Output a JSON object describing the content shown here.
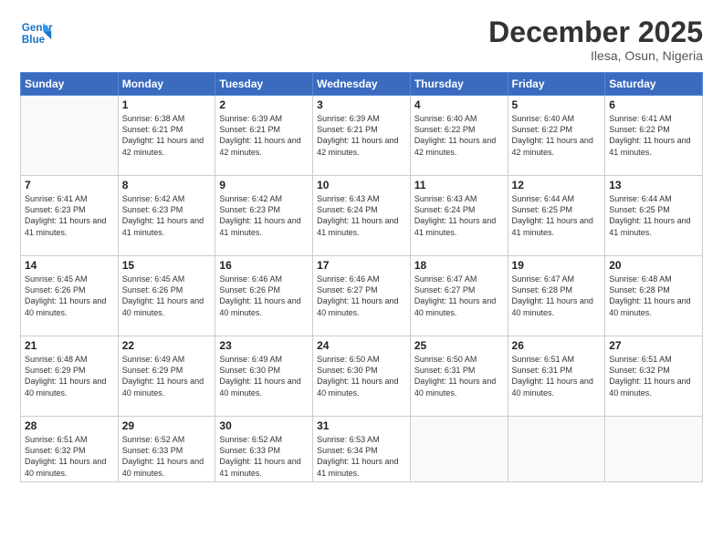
{
  "header": {
    "logo_line1": "General",
    "logo_line2": "Blue",
    "month_title": "December 2025",
    "location": "Ilesa, Osun, Nigeria"
  },
  "weekdays": [
    "Sunday",
    "Monday",
    "Tuesday",
    "Wednesday",
    "Thursday",
    "Friday",
    "Saturday"
  ],
  "weeks": [
    [
      {
        "day": "",
        "sunrise": "",
        "sunset": "",
        "daylight": ""
      },
      {
        "day": "1",
        "sunrise": "Sunrise: 6:38 AM",
        "sunset": "Sunset: 6:21 PM",
        "daylight": "Daylight: 11 hours and 42 minutes."
      },
      {
        "day": "2",
        "sunrise": "Sunrise: 6:39 AM",
        "sunset": "Sunset: 6:21 PM",
        "daylight": "Daylight: 11 hours and 42 minutes."
      },
      {
        "day": "3",
        "sunrise": "Sunrise: 6:39 AM",
        "sunset": "Sunset: 6:21 PM",
        "daylight": "Daylight: 11 hours and 42 minutes."
      },
      {
        "day": "4",
        "sunrise": "Sunrise: 6:40 AM",
        "sunset": "Sunset: 6:22 PM",
        "daylight": "Daylight: 11 hours and 42 minutes."
      },
      {
        "day": "5",
        "sunrise": "Sunrise: 6:40 AM",
        "sunset": "Sunset: 6:22 PM",
        "daylight": "Daylight: 11 hours and 42 minutes."
      },
      {
        "day": "6",
        "sunrise": "Sunrise: 6:41 AM",
        "sunset": "Sunset: 6:22 PM",
        "daylight": "Daylight: 11 hours and 41 minutes."
      }
    ],
    [
      {
        "day": "7",
        "sunrise": "Sunrise: 6:41 AM",
        "sunset": "Sunset: 6:23 PM",
        "daylight": "Daylight: 11 hours and 41 minutes."
      },
      {
        "day": "8",
        "sunrise": "Sunrise: 6:42 AM",
        "sunset": "Sunset: 6:23 PM",
        "daylight": "Daylight: 11 hours and 41 minutes."
      },
      {
        "day": "9",
        "sunrise": "Sunrise: 6:42 AM",
        "sunset": "Sunset: 6:23 PM",
        "daylight": "Daylight: 11 hours and 41 minutes."
      },
      {
        "day": "10",
        "sunrise": "Sunrise: 6:43 AM",
        "sunset": "Sunset: 6:24 PM",
        "daylight": "Daylight: 11 hours and 41 minutes."
      },
      {
        "day": "11",
        "sunrise": "Sunrise: 6:43 AM",
        "sunset": "Sunset: 6:24 PM",
        "daylight": "Daylight: 11 hours and 41 minutes."
      },
      {
        "day": "12",
        "sunrise": "Sunrise: 6:44 AM",
        "sunset": "Sunset: 6:25 PM",
        "daylight": "Daylight: 11 hours and 41 minutes."
      },
      {
        "day": "13",
        "sunrise": "Sunrise: 6:44 AM",
        "sunset": "Sunset: 6:25 PM",
        "daylight": "Daylight: 11 hours and 41 minutes."
      }
    ],
    [
      {
        "day": "14",
        "sunrise": "Sunrise: 6:45 AM",
        "sunset": "Sunset: 6:26 PM",
        "daylight": "Daylight: 11 hours and 40 minutes."
      },
      {
        "day": "15",
        "sunrise": "Sunrise: 6:45 AM",
        "sunset": "Sunset: 6:26 PM",
        "daylight": "Daylight: 11 hours and 40 minutes."
      },
      {
        "day": "16",
        "sunrise": "Sunrise: 6:46 AM",
        "sunset": "Sunset: 6:26 PM",
        "daylight": "Daylight: 11 hours and 40 minutes."
      },
      {
        "day": "17",
        "sunrise": "Sunrise: 6:46 AM",
        "sunset": "Sunset: 6:27 PM",
        "daylight": "Daylight: 11 hours and 40 minutes."
      },
      {
        "day": "18",
        "sunrise": "Sunrise: 6:47 AM",
        "sunset": "Sunset: 6:27 PM",
        "daylight": "Daylight: 11 hours and 40 minutes."
      },
      {
        "day": "19",
        "sunrise": "Sunrise: 6:47 AM",
        "sunset": "Sunset: 6:28 PM",
        "daylight": "Daylight: 11 hours and 40 minutes."
      },
      {
        "day": "20",
        "sunrise": "Sunrise: 6:48 AM",
        "sunset": "Sunset: 6:28 PM",
        "daylight": "Daylight: 11 hours and 40 minutes."
      }
    ],
    [
      {
        "day": "21",
        "sunrise": "Sunrise: 6:48 AM",
        "sunset": "Sunset: 6:29 PM",
        "daylight": "Daylight: 11 hours and 40 minutes."
      },
      {
        "day": "22",
        "sunrise": "Sunrise: 6:49 AM",
        "sunset": "Sunset: 6:29 PM",
        "daylight": "Daylight: 11 hours and 40 minutes."
      },
      {
        "day": "23",
        "sunrise": "Sunrise: 6:49 AM",
        "sunset": "Sunset: 6:30 PM",
        "daylight": "Daylight: 11 hours and 40 minutes."
      },
      {
        "day": "24",
        "sunrise": "Sunrise: 6:50 AM",
        "sunset": "Sunset: 6:30 PM",
        "daylight": "Daylight: 11 hours and 40 minutes."
      },
      {
        "day": "25",
        "sunrise": "Sunrise: 6:50 AM",
        "sunset": "Sunset: 6:31 PM",
        "daylight": "Daylight: 11 hours and 40 minutes."
      },
      {
        "day": "26",
        "sunrise": "Sunrise: 6:51 AM",
        "sunset": "Sunset: 6:31 PM",
        "daylight": "Daylight: 11 hours and 40 minutes."
      },
      {
        "day": "27",
        "sunrise": "Sunrise: 6:51 AM",
        "sunset": "Sunset: 6:32 PM",
        "daylight": "Daylight: 11 hours and 40 minutes."
      }
    ],
    [
      {
        "day": "28",
        "sunrise": "Sunrise: 6:51 AM",
        "sunset": "Sunset: 6:32 PM",
        "daylight": "Daylight: 11 hours and 40 minutes."
      },
      {
        "day": "29",
        "sunrise": "Sunrise: 6:52 AM",
        "sunset": "Sunset: 6:33 PM",
        "daylight": "Daylight: 11 hours and 40 minutes."
      },
      {
        "day": "30",
        "sunrise": "Sunrise: 6:52 AM",
        "sunset": "Sunset: 6:33 PM",
        "daylight": "Daylight: 11 hours and 41 minutes."
      },
      {
        "day": "31",
        "sunrise": "Sunrise: 6:53 AM",
        "sunset": "Sunset: 6:34 PM",
        "daylight": "Daylight: 11 hours and 41 minutes."
      },
      {
        "day": "",
        "sunrise": "",
        "sunset": "",
        "daylight": ""
      },
      {
        "day": "",
        "sunrise": "",
        "sunset": "",
        "daylight": ""
      },
      {
        "day": "",
        "sunrise": "",
        "sunset": "",
        "daylight": ""
      }
    ]
  ]
}
